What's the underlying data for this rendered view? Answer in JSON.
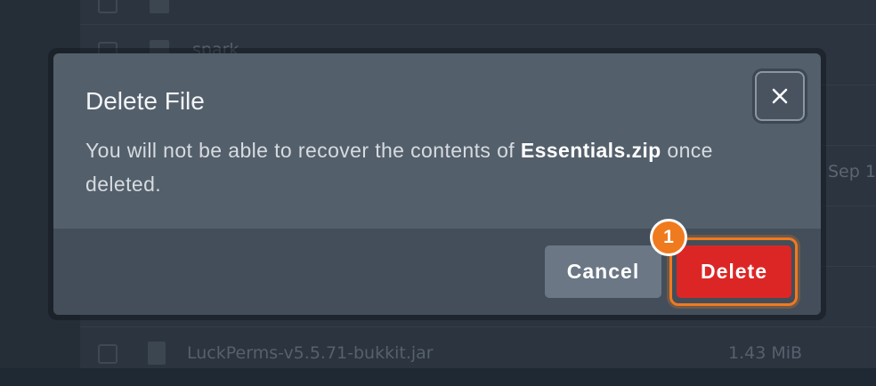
{
  "background": {
    "rows": [
      {
        "name": "",
        "size": ""
      },
      {
        "name": "spark",
        "size": ""
      },
      {
        "name": "",
        "size": ""
      },
      {
        "name": "",
        "size": ""
      },
      {
        "name": "",
        "size": ""
      },
      {
        "name": "LuckPerms-v5.5.71-bukkit.jar",
        "size": "1.43 MiB"
      }
    ],
    "date_fragment": "Sep 1"
  },
  "dialog": {
    "title": "Delete File",
    "body_prefix": "You will not be able to recover the contents of ",
    "file_name": "Essentials.zip",
    "body_suffix": " once deleted.",
    "close_icon": "close-icon",
    "cancel_label": "Cancel",
    "delete_label": "Delete"
  },
  "annotation": {
    "step_number": "1",
    "color": "#f07a1e"
  },
  "colors": {
    "danger": "#dc2626",
    "dialog_bg": "#535f6b",
    "footer_bg": "#434e5a"
  }
}
